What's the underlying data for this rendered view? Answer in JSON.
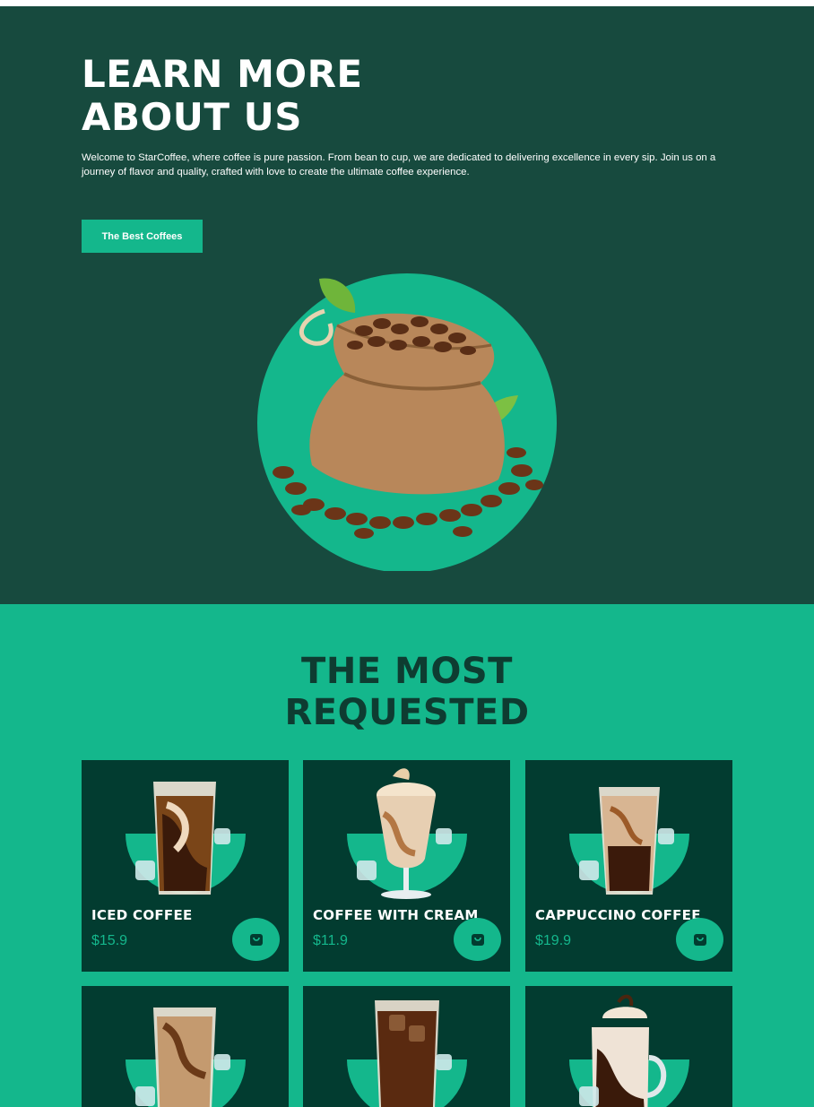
{
  "about": {
    "title_line1": "LEARN MORE",
    "title_line2": "ABOUT US",
    "description": "Welcome to StarCoffee, where coffee is pure passion. From bean to cup, we are dedicated to delivering excellence in every sip. Join us on a journey of flavor and quality, crafted with love to create the ultimate coffee experience.",
    "button_label": "The Best Coffees",
    "image_icon": "coffee-bean-sack"
  },
  "requested": {
    "title_line1": "THE MOST",
    "title_line2": "REQUESTED",
    "products": [
      {
        "name": "ICED COFFEE",
        "price": "$15.9",
        "icon": "cart-icon"
      },
      {
        "name": "COFFEE WITH CREAM",
        "price": "$11.9",
        "icon": "cart-icon"
      },
      {
        "name": "CAPPUCCINO COFFEE",
        "price": "$19.9",
        "icon": "cart-icon"
      },
      {
        "name": "",
        "price": "",
        "icon": "cart-icon"
      },
      {
        "name": "",
        "price": "",
        "icon": "cart-icon"
      },
      {
        "name": "",
        "price": "",
        "icon": "cart-icon"
      }
    ]
  },
  "colors": {
    "dark_green": "#174a3e",
    "accent": "#14b78c",
    "card_bg": "#023c30"
  }
}
